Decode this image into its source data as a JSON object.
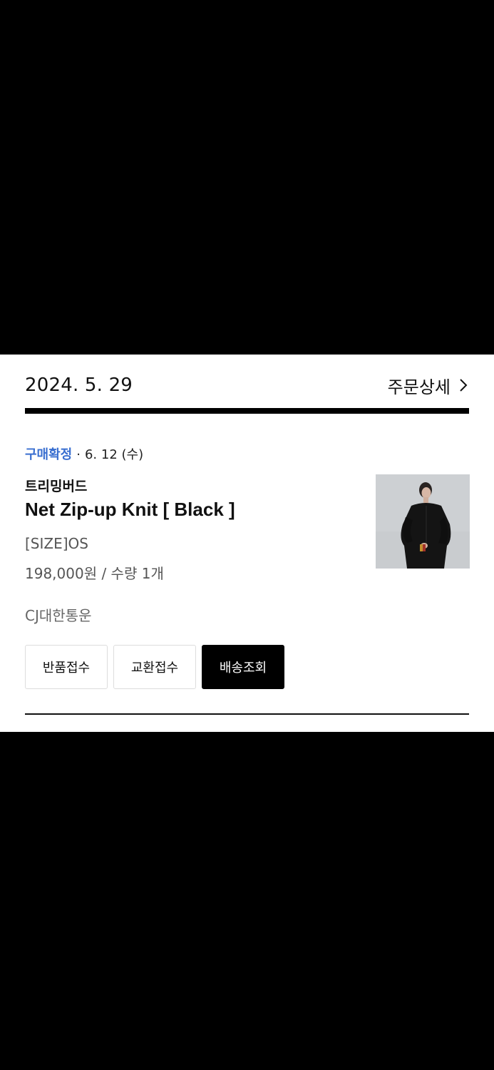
{
  "order": {
    "date": "2024. 5. 29",
    "detail_label": "주문상세"
  },
  "item": {
    "status": "구매확정",
    "separator": "·",
    "status_date": "6. 12 (수)",
    "brand": "트리밍버드",
    "name": "Net Zip-up Knit [ Black ]",
    "option": "[SIZE]OS",
    "price_quantity": "198,000원 / 수량 1개",
    "carrier": "CJ대한통운",
    "thumbnail_icon": "product-photo"
  },
  "actions": {
    "return_label": "반품접수",
    "exchange_label": "교환접수",
    "tracking_label": "배송조회"
  },
  "colors": {
    "status": "#3a6fd0",
    "primary_button": "#000000",
    "background": "#000000",
    "card": "#ffffff"
  }
}
